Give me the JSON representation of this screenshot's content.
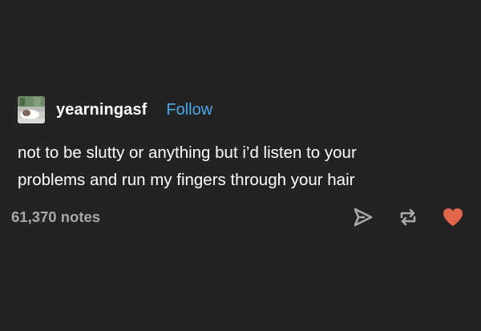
{
  "post": {
    "username": "yearningasf",
    "follow_label": "Follow",
    "body_lines": [
      "not to be slutty or anything but i’d listen to your",
      "problems and run my fingers through your hair"
    ],
    "notes": "61,370 notes"
  },
  "icons": {
    "share": "send-icon",
    "reblog": "reblog-icon",
    "like": "heart-icon"
  },
  "colors": {
    "background": "#232323",
    "text": "#ffffff",
    "follow": "#4aa8e8",
    "notes": "#a9a9a9",
    "icon": "#a9a9a9",
    "heart": "#e2664b"
  }
}
